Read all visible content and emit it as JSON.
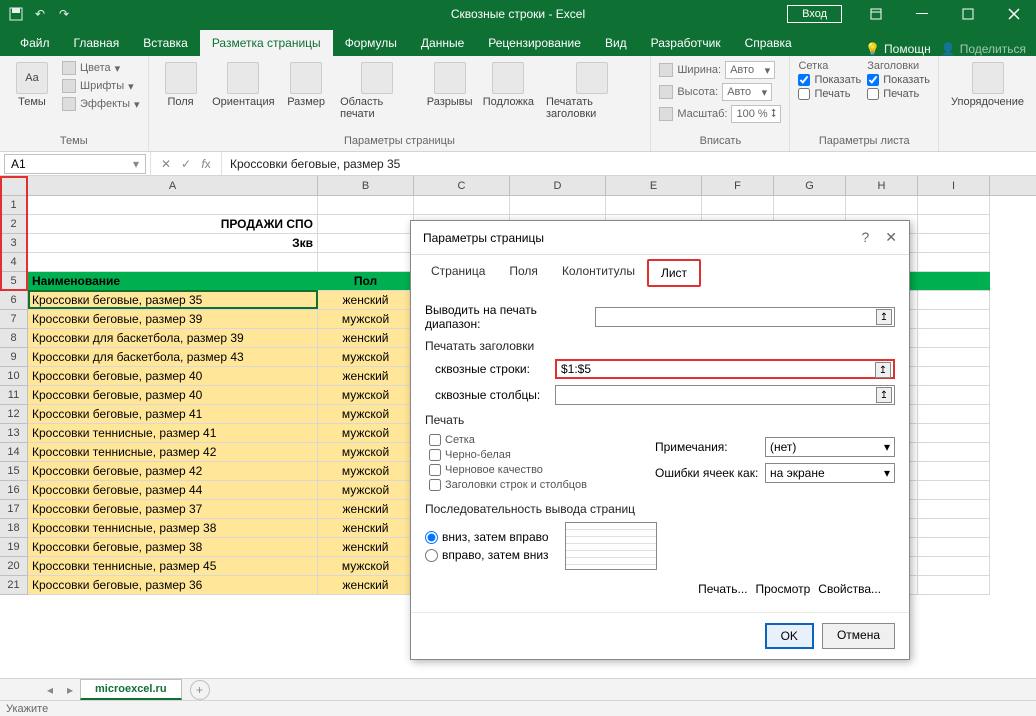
{
  "titlebar": {
    "title": "Сквозные строки - Excel",
    "login": "Вход"
  },
  "ribbon_tabs": [
    "Файл",
    "Главная",
    "Вставка",
    "Разметка страницы",
    "Формулы",
    "Данные",
    "Рецензирование",
    "Вид",
    "Разработчик",
    "Справка"
  ],
  "ribbon_active_tab": 3,
  "ribbon_help": "Помощн",
  "ribbon_share": "Поделиться",
  "groups": {
    "themes": {
      "label": "Темы",
      "main": "Темы",
      "colors": "Цвета",
      "fonts": "Шрифты",
      "effects": "Эффекты"
    },
    "pagesetup": {
      "label": "Параметры страницы",
      "margins": "Поля",
      "orientation": "Ориентация",
      "size": "Размер",
      "printarea": "Область печати",
      "breaks": "Разрывы",
      "background": "Подложка",
      "printtitles": "Печатать заголовки"
    },
    "scale": {
      "label": "Вписать",
      "width": "Ширина:",
      "height": "Высота:",
      "scale": "Масштаб:",
      "auto": "Авто",
      "scale_val": "100 %"
    },
    "sheetopts": {
      "label": "Параметры листа",
      "grid": "Сетка",
      "headings": "Заголовки",
      "show": "Показать",
      "print": "Печать"
    },
    "arrange": {
      "label": "",
      "main": "Упорядочение"
    }
  },
  "namebox": "A1",
  "formula": "Кроссовки беговые, размер 35",
  "columns": [
    "A",
    "B",
    "C",
    "D",
    "E",
    "F",
    "G",
    "H",
    "I"
  ],
  "title_row": "ПРОДАЖИ СПО",
  "subtitle_row": "Зкв",
  "headers": {
    "a": "Наименование",
    "b": "Пол"
  },
  "rows": [
    {
      "n": 6,
      "a": "Кроссовки беговые, размер 35",
      "b": "женский"
    },
    {
      "n": 7,
      "a": "Кроссовки беговые, размер 39",
      "b": "мужской"
    },
    {
      "n": 8,
      "a": "Кроссовки для баскетбола, размер 39",
      "b": "женский"
    },
    {
      "n": 9,
      "a": "Кроссовки для баскетбола, размер 43",
      "b": "мужской"
    },
    {
      "n": 10,
      "a": "Кроссовки беговые, размер 40",
      "b": "женский"
    },
    {
      "n": 11,
      "a": "Кроссовки беговые, размер 40",
      "b": "мужской"
    },
    {
      "n": 12,
      "a": "Кроссовки беговые, размер 41",
      "b": "мужской"
    },
    {
      "n": 13,
      "a": "Кроссовки теннисные, размер 41",
      "b": "мужской"
    },
    {
      "n": 14,
      "a": "Кроссовки теннисные, размер 42",
      "b": "мужской"
    },
    {
      "n": 15,
      "a": "Кроссовки беговые, размер 42",
      "b": "мужской"
    },
    {
      "n": 16,
      "a": "Кроссовки беговые, размер 44",
      "b": "мужской"
    },
    {
      "n": 17,
      "a": "Кроссовки беговые, размер 37",
      "b": "женский"
    },
    {
      "n": 18,
      "a": "Кроссовки теннисные, размер 38",
      "b": "женский"
    },
    {
      "n": 19,
      "a": "Кроссовки беговые, размер 38",
      "b": "женский"
    },
    {
      "n": 20,
      "a": "Кроссовки теннисные, размер 45",
      "b": "мужской"
    },
    {
      "n": 21,
      "a": "Кроссовки беговые, размер 36",
      "b": "женский"
    }
  ],
  "dialog": {
    "title": "Параметры страницы",
    "tabs": [
      "Страница",
      "Поля",
      "Колонтитулы",
      "Лист"
    ],
    "active_tab": 3,
    "print_range_label": "Выводить на печать диапазон:",
    "print_titles": "Печатать заголовки",
    "rows_label": "сквозные строки:",
    "rows_value": "$1:$5",
    "cols_label": "сквозные столбцы:",
    "print_section": "Печать",
    "checks": [
      "Сетка",
      "Черно-белая",
      "Черновое качество",
      "Заголовки строк и столбцов"
    ],
    "comments_label": "Примечания:",
    "comments_value": "(нет)",
    "errors_label": "Ошибки ячеек как:",
    "errors_value": "на экране",
    "order_section": "Последовательность вывода страниц",
    "radio1": "вниз, затем вправо",
    "radio2": "вправо, затем вниз",
    "btn_print": "Печать...",
    "btn_preview": "Просмотр",
    "btn_props": "Свойства...",
    "btn_ok": "OK",
    "btn_cancel": "Отмена"
  },
  "sheet_tab": "microexcel.ru",
  "status": "Укажите"
}
